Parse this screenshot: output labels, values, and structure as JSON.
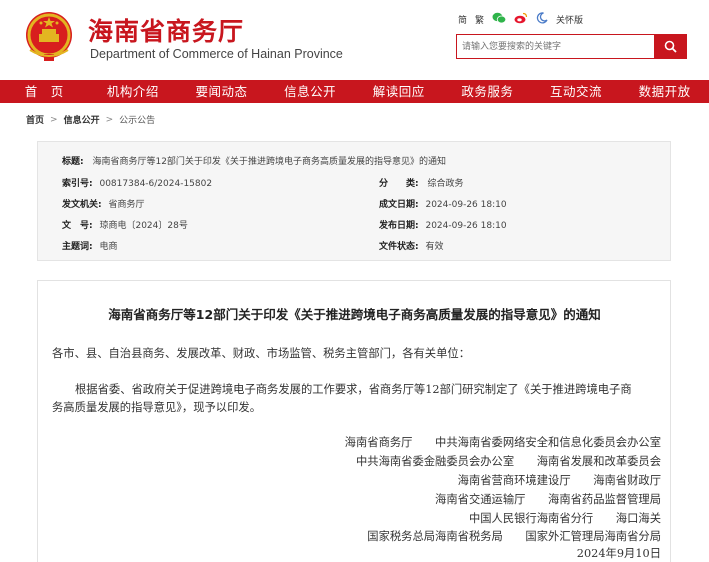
{
  "header": {
    "title": "海南省商务厅",
    "subtitle": "Department of Commerce of Hainan Province",
    "top_links": {
      "simplified": "简",
      "traditional": "繁",
      "care": "关怀版"
    },
    "search_placeholder": "请输入您要搜索的关键字"
  },
  "nav": [
    "首　页",
    "机构介绍",
    "要闻动态",
    "信息公开",
    "解读回应",
    "政务服务",
    "互动交流",
    "数据开放"
  ],
  "breadcrumb": {
    "home": "首页",
    "section": "信息公开",
    "current": "公示公告",
    "sep": ">"
  },
  "meta": {
    "subject_label": "标题:",
    "subject_value": "海南省商务厅等12部门关于印发《关于推进跨境电子商务高质量发展的指导意见》的通知",
    "index_label": "索引号:",
    "index_value": "00817384-6/2024-15802",
    "category_label": "分　　类:",
    "category_value": "综合政务",
    "issuer_label": "发文机关:",
    "issuer_value": "省商务厅",
    "created_label": "成文日期:",
    "created_value": "2024-09-26 18:10",
    "docno_label": "文　号:",
    "docno_value": "琼商电〔2024〕28号",
    "published_label": "发布日期:",
    "published_value": "2024-09-26 18:10",
    "topic_label": "主题词:",
    "topic_value": "电商",
    "status_label": "文件状态:",
    "status_value": "有效"
  },
  "document": {
    "title": "海南省商务厅等12部门关于印发《关于推进跨境电子商务高质量发展的指导意见》的通知",
    "salutation": "各市、县、自治县商务、发展改革、财政、市场监管、税务主管部门，各有关单位：",
    "body_line1": "根据省委、省政府关于促进跨境电子商务发展的工作要求，省商务厅等12部门研究制定了《关于推进跨境电子商",
    "body_line2": "务高质量发展的指导意见》，现予以印发。",
    "signatories": [
      "海南省商务厅　　中共海南省委网络安全和信息化委员会办公室",
      "中共海南省委金融委员会办公室　　海南省发展和改革委员会",
      "海南省营商环境建设厅　　海南省财政厅",
      "海南省交通运输厅　　海南省药品监督管理局",
      "中国人民银行海南省分行　　海口海关",
      "国家税务总局海南省税务局　　国家外汇管理局海南省分局"
    ],
    "date": "2024年9月10日"
  },
  "colors": {
    "brand_red": "#c8161e",
    "emblem_gold": "#e3b521"
  },
  "icons": [
    "emblem-icon",
    "wechat-icon",
    "weibo-icon",
    "moon-icon",
    "search-icon"
  ]
}
